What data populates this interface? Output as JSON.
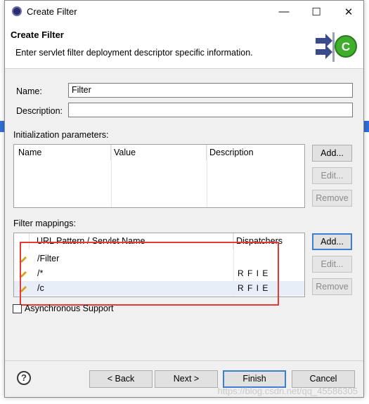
{
  "window": {
    "title": "Create Filter",
    "minimize_glyph": "—",
    "maximize_glyph": "☐",
    "close_glyph": "✕"
  },
  "header": {
    "title": "Create Filter",
    "description": "Enter servlet filter deployment descriptor specific information."
  },
  "form": {
    "name_label": "Name:",
    "name_value": "Filter",
    "description_label": "Description:",
    "description_value": ""
  },
  "init_params": {
    "section_label": "Initialization parameters:",
    "columns": [
      "Name",
      "Value",
      "Description"
    ],
    "buttons": {
      "add": "Add...",
      "edit": "Edit...",
      "remove": "Remove"
    }
  },
  "filter_mappings": {
    "section_label": "Filter mappings:",
    "columns": [
      "URL Pattern / Servlet Name",
      "Dispatchers"
    ],
    "rows": [
      {
        "pattern": "/Filter",
        "dispatchers": ""
      },
      {
        "pattern": "/*",
        "dispatchers": "R F I E"
      },
      {
        "pattern": "/c",
        "dispatchers": "R F I E"
      }
    ],
    "buttons": {
      "add": "Add...",
      "edit": "Edit...",
      "remove": "Remove"
    }
  },
  "async_support_label": "Asynchronous Support",
  "footer": {
    "help_glyph": "?",
    "back": "< Back",
    "next": "Next >",
    "finish": "Finish",
    "cancel": "Cancel"
  },
  "watermark": "https://blog.csdn.net/qq_45586305",
  "colors": {
    "highlight_box": "#e53935",
    "default_button_border": "#3c7fd2",
    "icon_green": "#3fae2a"
  }
}
